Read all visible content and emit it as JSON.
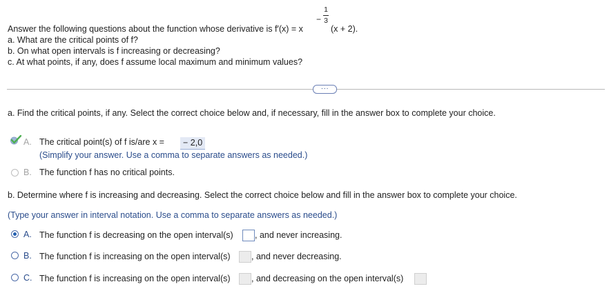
{
  "question": {
    "intro_text": "Answer the following questions about the function whose derivative is f′(x) = x",
    "frac_num": "1",
    "frac_den": "3",
    "intro_tail": "(x + 2).",
    "part_a": "a. What are the critical points of f?",
    "part_b": "b. On what open intervals is f increasing or decreasing?",
    "part_c": "c. At what points, if any, does f assume local maximum and minimum values?"
  },
  "more_button": "···",
  "part_a": {
    "instruction": "a. Find the critical points, if any. Select the correct choice below and, if necessary, fill in the answer box to complete your choice.",
    "choice_a_letter": "A.",
    "choice_a_text": "The critical point(s) of f is/are x =",
    "choice_a_answer": "− 2,0",
    "choice_a_end": ".",
    "choice_a_hint": "(Simplify your answer. Use a comma to separate answers as needed.)",
    "choice_b_letter": "B.",
    "choice_b_text": "The function f has no critical points."
  },
  "part_b": {
    "instruction": "b. Determine where f is increasing and decreasing. Select the correct choice below and fill in the answer box to complete your choice.",
    "hint": "(Type your answer in interval notation. Use a comma to separate answers as needed.)",
    "choice_a_letter": "A.",
    "choice_a_text": "The function f is decreasing on the open interval(s)",
    "choice_a_tail": ", and never increasing.",
    "choice_b_letter": "B.",
    "choice_b_text": "The function f is increasing on the open interval(s)",
    "choice_b_tail": ", and never decreasing.",
    "choice_c_letter": "C.",
    "choice_c_text": "The function f is increasing on the open interval(s)",
    "choice_c_tail": ", and decreasing on the open interval(s)"
  },
  "colors": {
    "accent_blue": "#2b4d8c",
    "selected_radio": "#2460b0",
    "check_green": "#4caf50"
  }
}
